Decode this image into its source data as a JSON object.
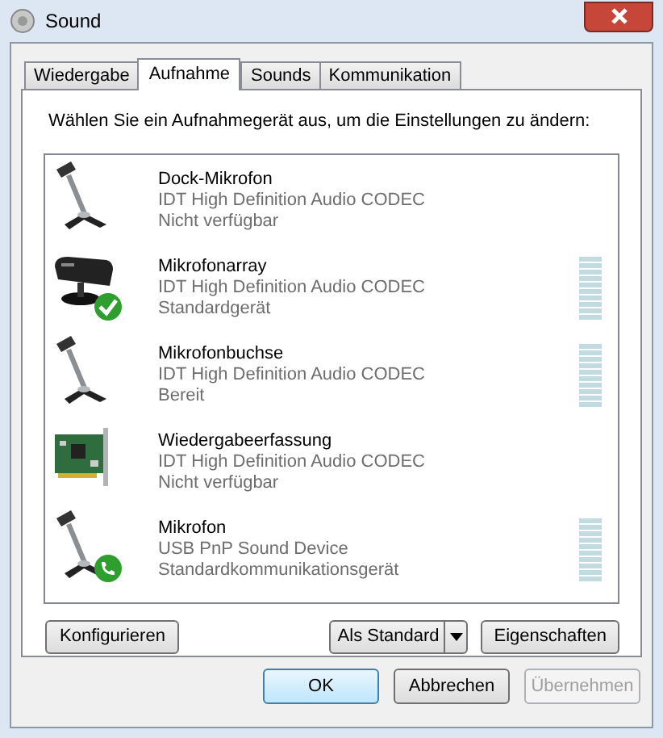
{
  "window": {
    "title": "Sound"
  },
  "tabs": [
    {
      "label": "Wiedergabe",
      "selected": false
    },
    {
      "label": "Aufnahme",
      "selected": true
    },
    {
      "label": "Sounds",
      "selected": false
    },
    {
      "label": "Kommunikation",
      "selected": false
    }
  ],
  "instruction": "Wählen Sie ein Aufnahmegerät aus, um die Einstellungen zu ändern:",
  "devices": [
    {
      "kind": "mic",
      "default_device": false,
      "communication_device": false,
      "name": "Dock-Mikrofon",
      "driver": "IDT High Definition Audio CODEC",
      "status": "Nicht verfügbar",
      "meter": false
    },
    {
      "kind": "array",
      "default_device": true,
      "communication_device": false,
      "name": "Mikrofonarray",
      "driver": "IDT High Definition Audio CODEC",
      "status": "Standardgerät",
      "meter": true
    },
    {
      "kind": "mic",
      "default_device": false,
      "communication_device": false,
      "name": "Mikrofonbuchse",
      "driver": "IDT High Definition Audio CODEC",
      "status": "Bereit",
      "meter": true
    },
    {
      "kind": "card",
      "default_device": false,
      "communication_device": false,
      "name": "Wiedergabeerfassung",
      "driver": "IDT High Definition Audio CODEC",
      "status": "Nicht verfügbar",
      "meter": false
    },
    {
      "kind": "mic",
      "default_device": false,
      "communication_device": true,
      "name": "Mikrofon",
      "driver": "USB PnP Sound Device",
      "status": "Standardkommunikationsgerät",
      "meter": true
    }
  ],
  "panel_buttons": {
    "configure": "Konfigurieren",
    "set_default": "Als Standard",
    "properties": "Eigenschaften"
  },
  "dialog_buttons": [
    {
      "label": "OK",
      "disabled": false,
      "default": true
    },
    {
      "label": "Abbrechen",
      "disabled": false,
      "default": false
    },
    {
      "label": "Übernehmen",
      "disabled": true,
      "default": false
    }
  ]
}
